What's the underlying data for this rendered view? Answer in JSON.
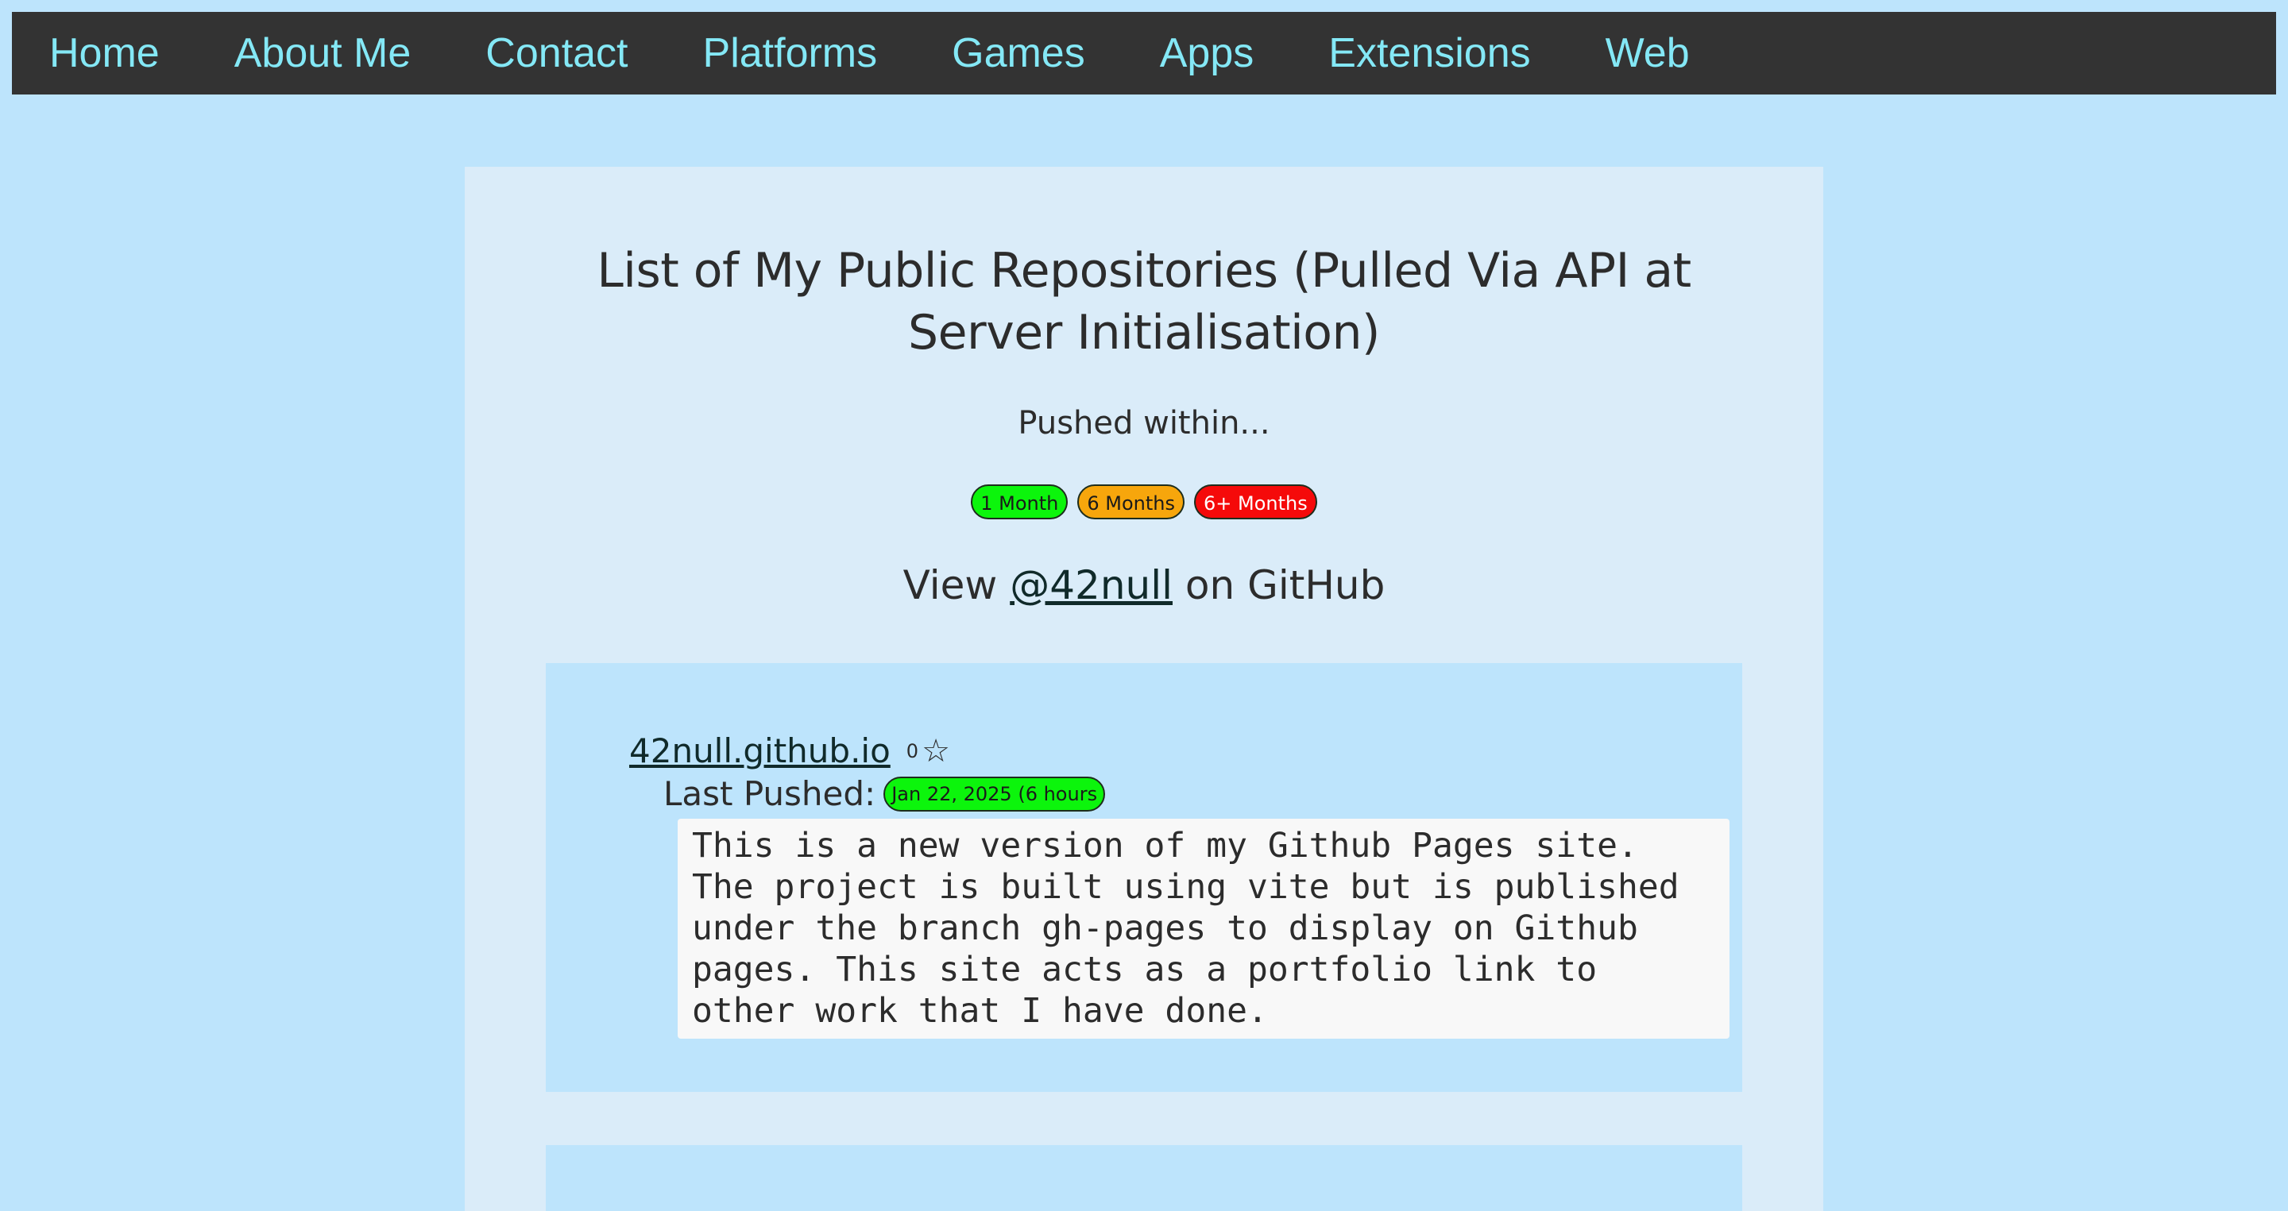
{
  "nav": {
    "items": [
      {
        "label": "Home"
      },
      {
        "label": "About Me"
      },
      {
        "label": "Contact"
      },
      {
        "label": "Platforms"
      },
      {
        "label": "Games"
      },
      {
        "label": "Apps"
      },
      {
        "label": "Extensions"
      },
      {
        "label": "Web"
      }
    ]
  },
  "header": {
    "title_line1": "List of My Public Repositories (Pulled Via API at",
    "title_line2": "Server Initialisation)",
    "pushed_within": "Pushed within...",
    "legend": [
      "1 Month",
      "6 Months",
      "6+ Months"
    ],
    "view_prefix": "View",
    "github_handle": "@42null",
    "view_suffix": "on GitHub"
  },
  "repos": [
    {
      "name": "42null.github.io",
      "stars": "0",
      "star_icon": "star-outline-icon",
      "last_pushed_label": "Last Pushed:",
      "last_pushed_value": "Jan 22, 2025 (6 hours",
      "description_lines": [
        "This is a new version of my Github Pages site.",
        "The project is built using vite but is published",
        "under the branch gh-pages to display on Github",
        "pages. This site acts as a portfolio link to",
        "other work that I have done."
      ]
    }
  ],
  "colors": {
    "background": "#bde4fc",
    "nav_background": "#333333",
    "nav_link": "#84e8f6",
    "panel": "#daecf9",
    "recent_green": "#0cf50c",
    "mid_orange": "#f7a60c",
    "old_red": "#f50a0a"
  }
}
